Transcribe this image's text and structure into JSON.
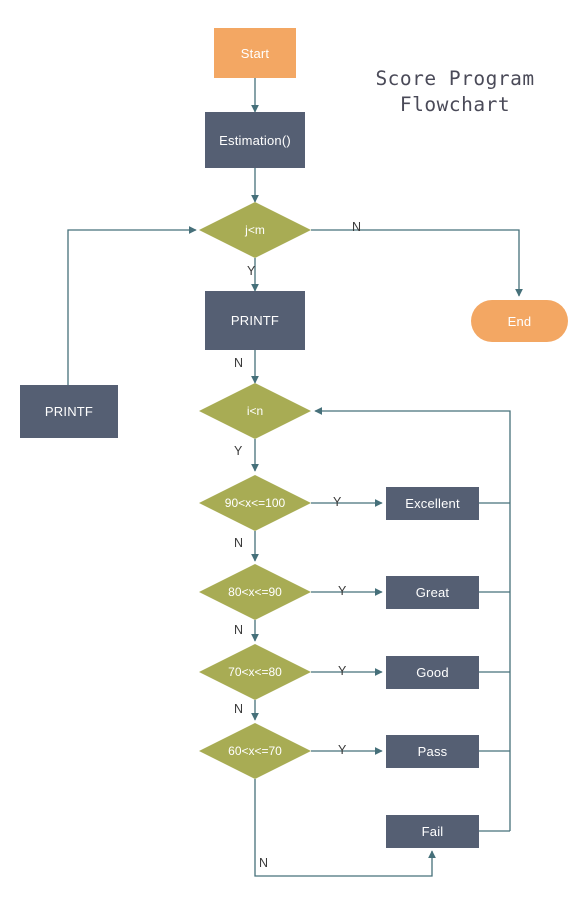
{
  "title": {
    "line1": "Score Program",
    "line2": "Flowchart"
  },
  "colors": {
    "terminator": "#F3A763",
    "process": "#555F73",
    "decision": "#A8AC54",
    "connector": "#46707A",
    "label_text": "#3a3a3a",
    "title_text": "#4a4a58",
    "background": "#ffffff"
  },
  "nodes": {
    "start": {
      "label": "Start",
      "type": "terminator-rect"
    },
    "estimation": {
      "label": "Estimation()",
      "type": "process"
    },
    "dec_j": {
      "label": "j<m",
      "type": "decision"
    },
    "printf_main": {
      "label": "PRINTF",
      "type": "process"
    },
    "printf_left": {
      "label": "PRINTF",
      "type": "process"
    },
    "dec_i": {
      "label": "i<n",
      "type": "decision"
    },
    "dec_90": {
      "label": "90<x<=100",
      "type": "decision"
    },
    "dec_80": {
      "label": "80<x<=90",
      "type": "decision"
    },
    "dec_70": {
      "label": "70<x<=80",
      "type": "decision"
    },
    "dec_60": {
      "label": "60<x<=70",
      "type": "decision"
    },
    "excellent": {
      "label": "Excellent",
      "type": "process"
    },
    "great": {
      "label": "Great",
      "type": "process"
    },
    "good": {
      "label": "Good",
      "type": "process"
    },
    "pass": {
      "label": "Pass",
      "type": "process"
    },
    "fail": {
      "label": "Fail",
      "type": "process"
    },
    "end": {
      "label": "End",
      "type": "terminator-round"
    }
  },
  "edge_labels": {
    "j_no": "N",
    "j_yes": "Y",
    "printf_no": "N",
    "i_yes": "Y",
    "d90_yes": "Y",
    "d90_no": "N",
    "d80_yes": "Y",
    "d80_no": "N",
    "d70_yes": "Y",
    "d70_no": "N",
    "d60_yes": "Y",
    "d60_no": "N"
  }
}
